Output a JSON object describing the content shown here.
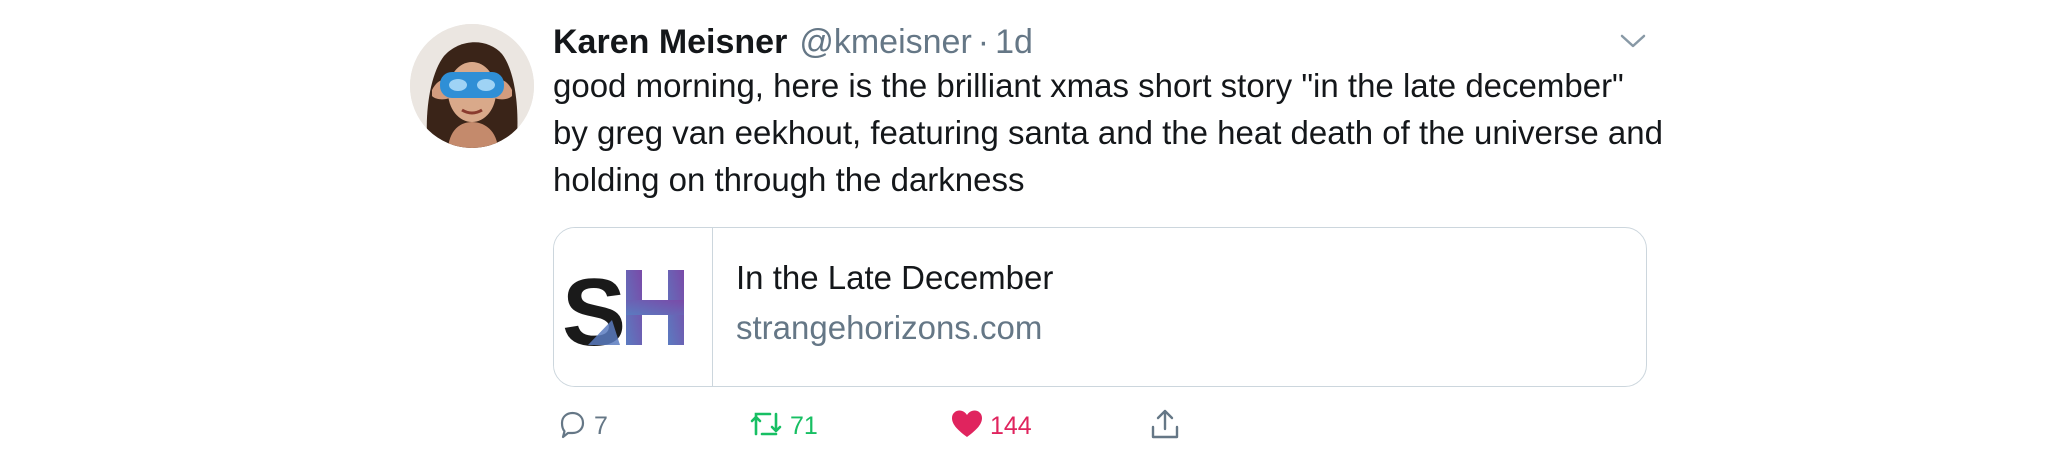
{
  "tweet": {
    "author_name": "Karen Meisner",
    "author_handle": "@kmeisner",
    "separator": "·",
    "time": "1d",
    "text": "good morning, here is the brilliant xmas short story \"in the late december\" by greg van eekhout, featuring santa and the heat death of the universe and holding on through the darkness",
    "card": {
      "title": "In the Late December",
      "domain": "strangehorizons.com",
      "logo_text": "SH"
    },
    "actions": {
      "reply_count": "7",
      "retweet_count": "71",
      "like_count": "144"
    }
  },
  "icons": {
    "menu": "chevron-down-icon",
    "reply": "reply-icon",
    "retweet": "retweet-icon",
    "like": "heart-icon",
    "share": "share-icon"
  },
  "colors": {
    "text": "#14171a",
    "secondary": "#657786",
    "border": "#ccd6dd",
    "retweet_green": "#17bf63",
    "like_red": "#e0245e",
    "logo_dark": "#1a1a1a",
    "logo_blue": "#5b7bc0",
    "logo_purple": "#7a4aa8"
  }
}
